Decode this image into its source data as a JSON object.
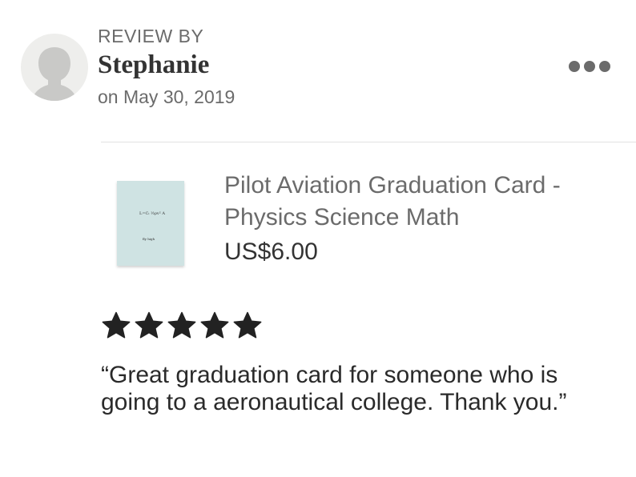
{
  "review": {
    "heading": "REVIEW BY",
    "reviewer_name": "Stephanie",
    "date": "on May 30, 2019",
    "rating": 5,
    "rating_max": 5,
    "text": "“Great graduation card for someone who is going to a aeronautical college. Thank you.”"
  },
  "product": {
    "title": "Pilot Aviation Graduation Card - Physics Science Math",
    "price": "US$6.00",
    "thumbnail_formula": "L=Cₗ ½ρv² A",
    "thumbnail_caption": "fly high"
  },
  "icons": {
    "avatar": "user-silhouette-icon",
    "more": "more-horizontal-icon",
    "star": "star-filled-icon"
  },
  "colors": {
    "secondary_text": "#6b6b6b",
    "primary_text": "#222222",
    "star": "#222222",
    "avatar_bg": "#eeeeec",
    "thumbnail_bg": "#cfe3e3",
    "divider": "#e2e2e2"
  }
}
